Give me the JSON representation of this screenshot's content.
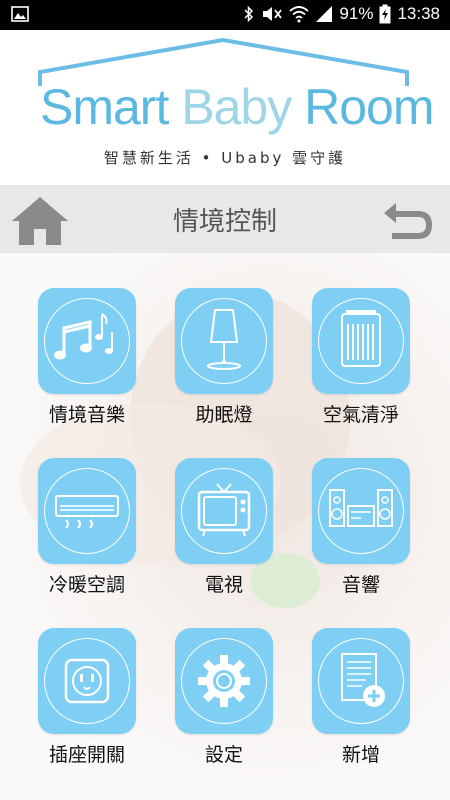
{
  "status_bar": {
    "battery": "91%",
    "time": "13:38"
  },
  "logo": {
    "part1": "Smart ",
    "part2": "Baby",
    "part3": " Room",
    "subtitle": "智慧新生活 • Ubaby 雲守護"
  },
  "titlebar": {
    "title": "情境控制"
  },
  "grid": [
    {
      "label": "情境音樂",
      "icon": "music-notes-icon"
    },
    {
      "label": "助眠燈",
      "icon": "lamp-icon"
    },
    {
      "label": "空氣清淨",
      "icon": "air-purifier-icon"
    },
    {
      "label": "冷暖空調",
      "icon": "air-conditioner-icon"
    },
    {
      "label": "電視",
      "icon": "tv-icon"
    },
    {
      "label": "音響",
      "icon": "stereo-icon"
    },
    {
      "label": "插座開關",
      "icon": "power-socket-icon"
    },
    {
      "label": "設定",
      "icon": "gear-icon"
    },
    {
      "label": "新增",
      "icon": "add-document-icon"
    }
  ],
  "colors": {
    "tile": "#7fcff5",
    "logo_blue": "#5bb8e0",
    "titlebar_bg": "#e8e8e8"
  }
}
